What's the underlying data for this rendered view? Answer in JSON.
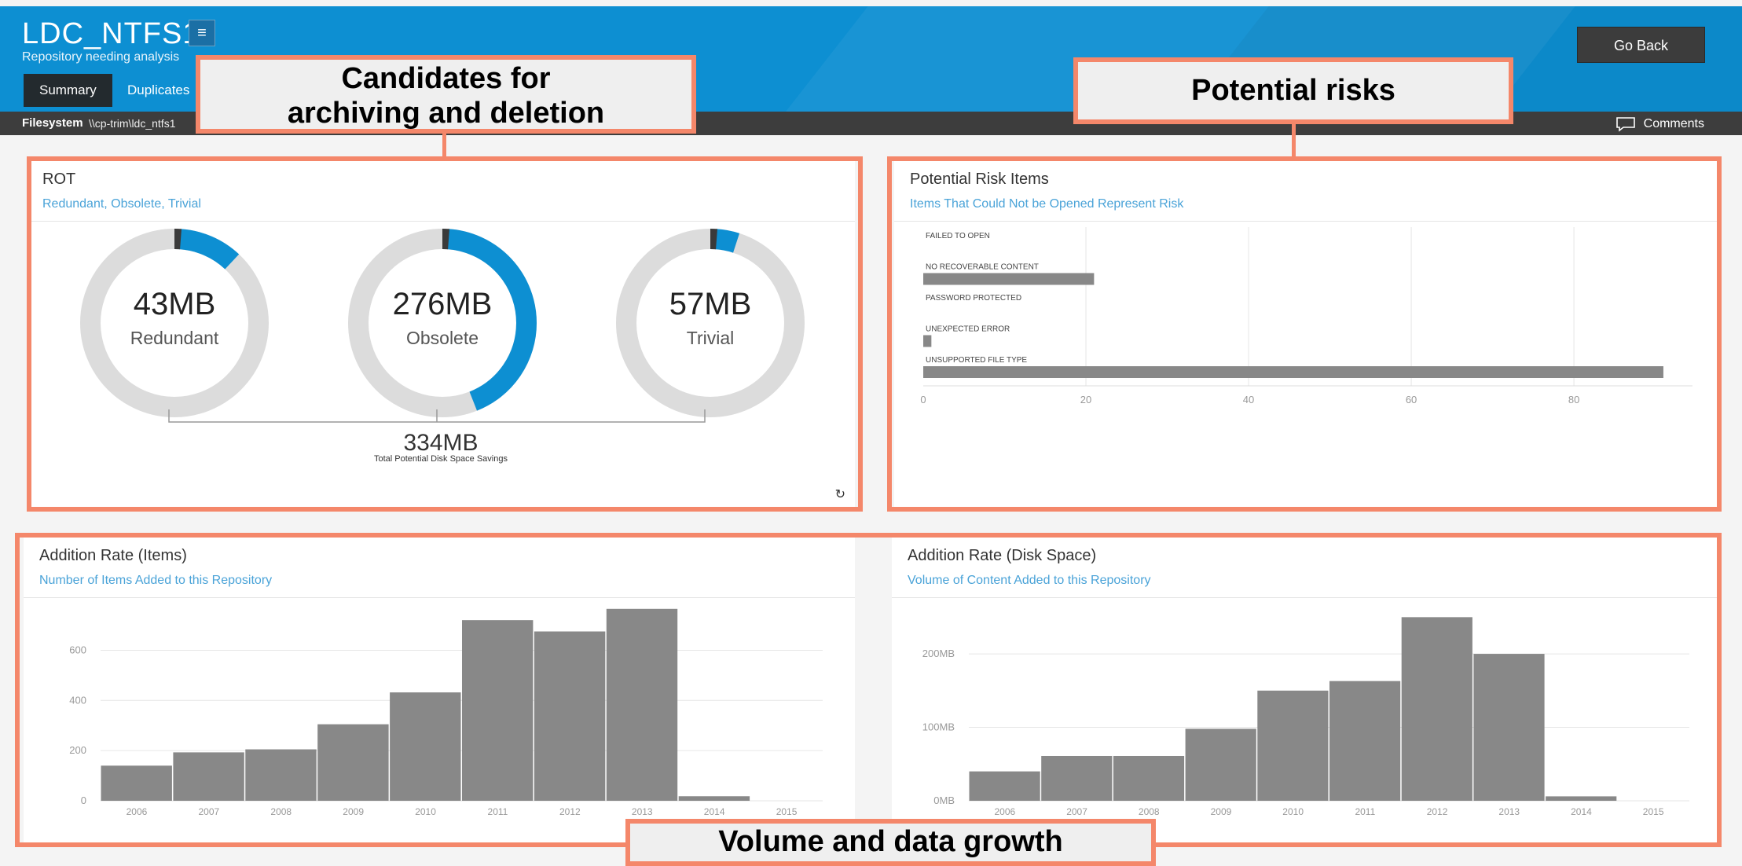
{
  "header": {
    "title": "LDC_NTFS1",
    "menu_icon": "hamburger-icon",
    "subtitle": "Repository needing analysis",
    "go_back": "Go Back",
    "tabs": [
      {
        "label": "Summary",
        "active": true
      },
      {
        "label": "Duplicates",
        "active": false
      }
    ]
  },
  "pathbar": {
    "label": "Filesystem",
    "path": "\\\\cp-trim\\ldc_ntfs1",
    "comments": "Comments",
    "comments_icon": "comment-icon"
  },
  "rot": {
    "title": "ROT",
    "subtitle": "Redundant, Obsolete, Trivial",
    "donuts": [
      {
        "value": "43MB",
        "label": "Redundant",
        "fraction": 0.11
      },
      {
        "value": "276MB",
        "label": "Obsolete",
        "fraction": 0.43
      },
      {
        "value": "57MB",
        "label": "Trivial",
        "fraction": 0.04
      }
    ],
    "total_value": "334MB",
    "total_label": "Total Potential Disk Space Savings",
    "refresh_icon": "refresh-icon"
  },
  "annotations": {
    "candidates": [
      "Candidates for",
      "archiving and deletion"
    ],
    "risks": "Potential risks",
    "volume": "Volume and data growth"
  },
  "colors": {
    "accent": "#0d8fd2",
    "bar": "#888888",
    "annotation": "#f4876a"
  },
  "chart_data": [
    {
      "type": "bar",
      "orientation": "horizontal",
      "title": "Potential Risk Items",
      "subtitle": "Items That Could Not be Opened Represent Risk",
      "categories": [
        "FAILED TO OPEN",
        "NO RECOVERABLE CONTENT",
        "PASSWORD PROTECTED",
        "UNEXPECTED ERROR",
        "UNSUPPORTED FILE TYPE"
      ],
      "values": [
        0,
        21,
        0,
        1,
        91
      ],
      "ticks": [
        "0",
        "20",
        "40",
        "60",
        "80"
      ],
      "xlim": [
        0,
        94
      ],
      "grid": true
    },
    {
      "type": "bar",
      "title": "Addition Rate (Items)",
      "subtitle": "Number of Items Added to this Repository",
      "categories": [
        "2006",
        "2007",
        "2008",
        "2009",
        "2010",
        "2011",
        "2012",
        "2013",
        "2014",
        "2015"
      ],
      "values": [
        140,
        193,
        205,
        305,
        432,
        720,
        675,
        765,
        18,
        0
      ],
      "yticks": [
        "0",
        "200",
        "400",
        "600"
      ],
      "ylim": [
        0,
        780
      ],
      "grid": true
    },
    {
      "type": "bar",
      "title": "Addition Rate (Disk Space)",
      "subtitle": "Volume of Content Added to this Repository",
      "categories": [
        "2006",
        "2007",
        "2008",
        "2009",
        "2010",
        "2011",
        "2012",
        "2013",
        "2014",
        "2015"
      ],
      "values": [
        40,
        61,
        61,
        98,
        150,
        163,
        250,
        200,
        6,
        0
      ],
      "yticks": [
        "0MB",
        "100MB",
        "200MB"
      ],
      "ylim": [
        0,
        260
      ],
      "grid": true
    }
  ]
}
